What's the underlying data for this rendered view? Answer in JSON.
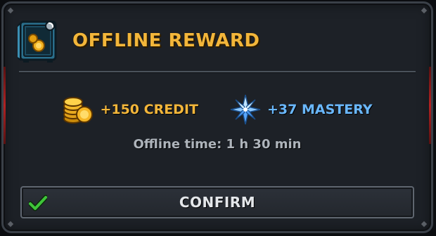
{
  "dialog": {
    "title": "OFFLINE REWARD",
    "title_icon": "safe-icon",
    "title_color": "#f3b63a"
  },
  "rewards": [
    {
      "icon": "gold-coins-icon",
      "label": "+150 CREDIT",
      "color": "#f3b63a"
    },
    {
      "icon": "blue-crystal-icon",
      "label": "+37 MASTERY",
      "color": "#6ab8ff"
    }
  ],
  "offline_time": "Offline time: 1 h 30 min",
  "confirm": {
    "label": "CONFIRM",
    "icon": "check-icon",
    "icon_color": "#3fc43a"
  }
}
